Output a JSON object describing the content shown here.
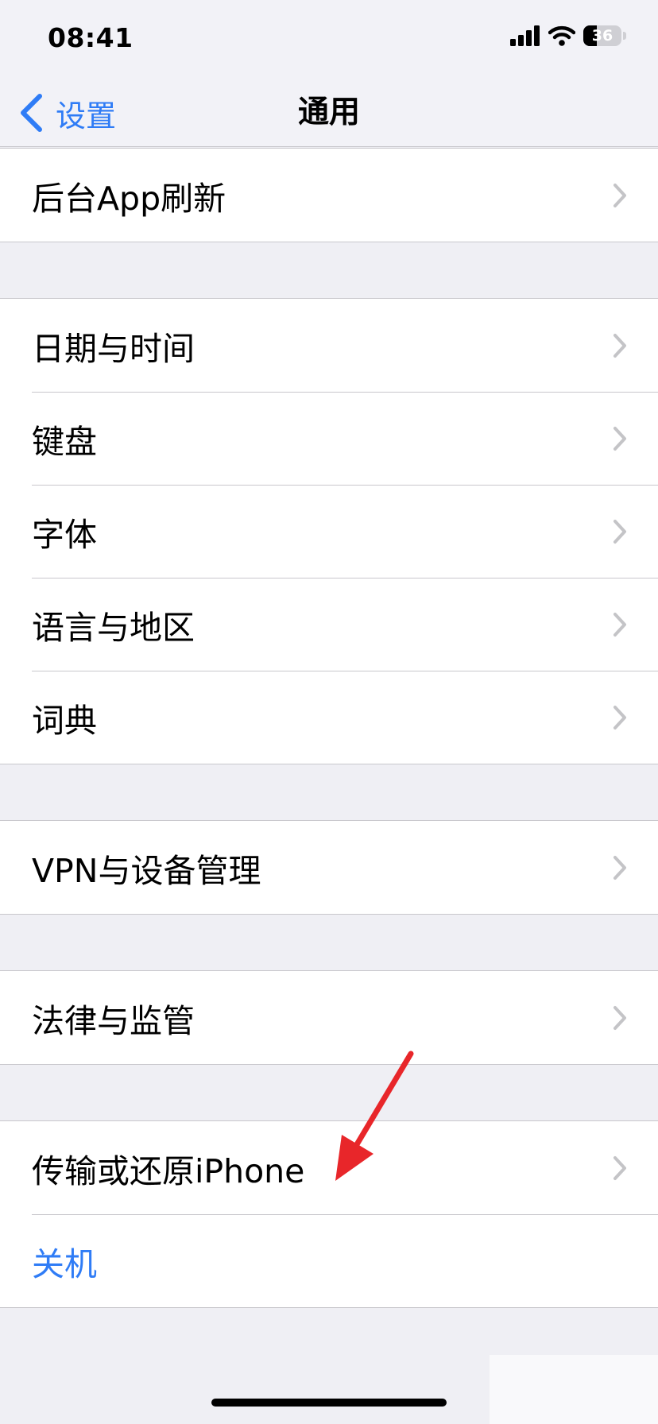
{
  "status_bar": {
    "time": "08:41",
    "battery": "36",
    "battery_level": 0.36
  },
  "nav": {
    "back_label": "设置",
    "title": "通用"
  },
  "groups": [
    {
      "rows": [
        {
          "label": "后台App刷新",
          "chevron": true
        }
      ]
    },
    {
      "rows": [
        {
          "label": "日期与时间",
          "chevron": true
        },
        {
          "label": "键盘",
          "chevron": true
        },
        {
          "label": "字体",
          "chevron": true
        },
        {
          "label": "语言与地区",
          "chevron": true
        },
        {
          "label": "词典",
          "chevron": true
        }
      ]
    },
    {
      "rows": [
        {
          "label": "VPN与设备管理",
          "chevron": true
        }
      ]
    },
    {
      "rows": [
        {
          "label": "法律与监管",
          "chevron": true
        }
      ]
    },
    {
      "rows": [
        {
          "label": "传输或还原iPhone",
          "chevron": true
        },
        {
          "label": "关机",
          "chevron": false,
          "style": "link"
        }
      ]
    }
  ],
  "colors": {
    "accent": "#2f7cf6",
    "arrow": "#e8262a",
    "background": "#efeff4"
  }
}
